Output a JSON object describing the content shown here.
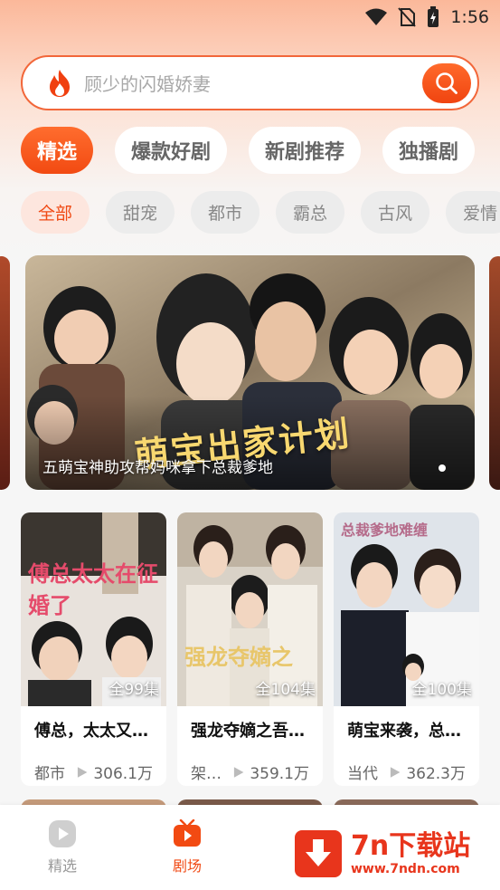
{
  "status": {
    "time": "1:56"
  },
  "search": {
    "placeholder": "顾少的闪婚娇妻"
  },
  "tabs": [
    "精选",
    "爆款好剧",
    "新剧推荐",
    "独播剧"
  ],
  "categories": [
    "全部",
    "甜宠",
    "都市",
    "霸总",
    "古风",
    "爱情"
  ],
  "banner": {
    "caption": "五萌宝神助攻帮妈咪拿下总裁爹地",
    "logo_text": "萌宝出家计划"
  },
  "dramas": [
    {
      "title": "傅总，太太又…",
      "episodes": "全99集",
      "genre": "都市",
      "views": "306.1万",
      "poster_text": "傅总太太在征婚了"
    },
    {
      "title": "强龙夺嫡之吾…",
      "episodes": "全104集",
      "genre": "架…",
      "views": "359.1万",
      "poster_text": "强龙夺嫡之"
    },
    {
      "title": "萌宝来袭，总…",
      "episodes": "全100集",
      "genre": "当代",
      "views": "362.3万",
      "poster_text": "总裁爹地难缠"
    }
  ],
  "bottom_nav": [
    {
      "label": "精选",
      "icon": "play-circle-icon"
    },
    {
      "label": "剧场",
      "icon": "tv-icon"
    }
  ],
  "watermark": {
    "title": "7n下载站",
    "url": "www.7ndn.com"
  },
  "colors": {
    "accent": "#f24a12",
    "accent_light": "#fde6de"
  }
}
